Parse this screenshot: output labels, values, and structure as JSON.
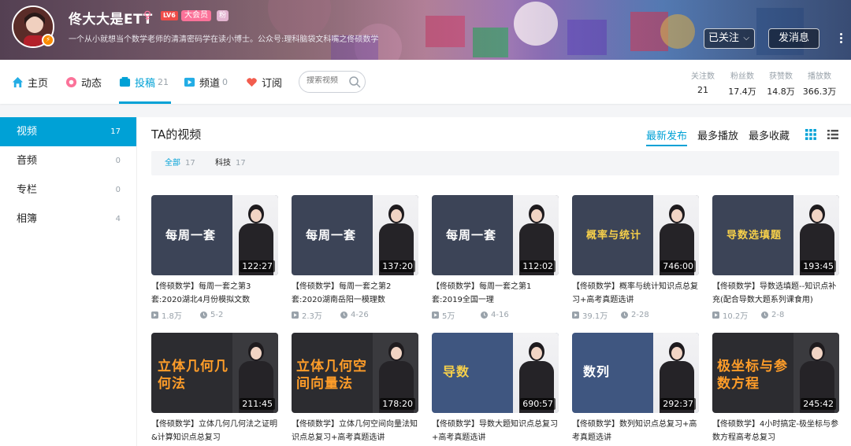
{
  "header": {
    "user_name": "佟大大是ETT",
    "level": "LV6",
    "vip": "大会员",
    "medal": "粉",
    "sign": "一个从小就想当个数学老师的清清密码学在读小博士。公众号:理科脑袋文科嘴之佟硕数学",
    "follow_label": "已关注",
    "message_label": "发消息"
  },
  "nav": {
    "tabs": [
      {
        "label": "主页",
        "count": ""
      },
      {
        "label": "动态",
        "count": ""
      },
      {
        "label": "投稿",
        "count": "21"
      },
      {
        "label": "频道",
        "count": "0"
      },
      {
        "label": "订阅",
        "count": ""
      }
    ],
    "search_placeholder": "搜索视频",
    "stats": [
      {
        "label": "关注数",
        "value": "21"
      },
      {
        "label": "粉丝数",
        "value": "17.4万"
      },
      {
        "label": "获赞数",
        "value": "14.8万"
      },
      {
        "label": "播放数",
        "value": "366.3万"
      }
    ]
  },
  "sidebar": {
    "items": [
      {
        "label": "视频",
        "count": "17"
      },
      {
        "label": "音频",
        "count": "0"
      },
      {
        "label": "专栏",
        "count": "0"
      },
      {
        "label": "相簿",
        "count": "4"
      }
    ]
  },
  "main": {
    "title": "TA的视频",
    "sort_tabs": [
      "最新发布",
      "最多播放",
      "最多收藏"
    ],
    "filters": [
      {
        "label": "全部",
        "count": "17"
      },
      {
        "label": "科技",
        "count": "17"
      }
    ],
    "videos": [
      {
        "cover": "每周一套",
        "duration": "122:27",
        "title": "【佟硕数学】每周一套之第3套:2020湖北4月份模拟文数",
        "plays": "1.8万",
        "date": "5-2"
      },
      {
        "cover": "每周一套",
        "duration": "137:20",
        "title": "【佟硕数学】每周一套之第2套:2020湖南岳阳一模理数",
        "plays": "2.3万",
        "date": "4-26"
      },
      {
        "cover": "每周一套",
        "duration": "112:02",
        "title": "【佟硕数学】每周一套之第1套:2019全国一理",
        "plays": "5万",
        "date": "4-16"
      },
      {
        "cover": "概率与统计",
        "duration": "746:00",
        "title": "【佟硕数学】概率与统计知识点总复习+高考真题选讲",
        "plays": "39.1万",
        "date": "2-28"
      },
      {
        "cover": "导数选填题",
        "duration": "193:45",
        "title": "【佟硕数学】导数选填题--知识点补充(配合导数大题系列课食用)",
        "plays": "10.2万",
        "date": "2-8"
      },
      {
        "cover": "立体几何几何法",
        "duration": "211:45",
        "title": "【佟硕数学】立体几何几何法之证明&计算知识点总复习",
        "plays": "",
        "date": ""
      },
      {
        "cover": "立体几何空间向量法",
        "duration": "178:20",
        "title": "【佟硕数学】立体几何空间向量法知识点总复习+高考真题选讲",
        "plays": "",
        "date": ""
      },
      {
        "cover": "导数",
        "duration": "690:57",
        "title": "【佟硕数学】导数大题知识点总复习+高考真题选讲",
        "plays": "",
        "date": ""
      },
      {
        "cover": "数列",
        "duration": "292:37",
        "title": "【佟硕数学】数列知识点总复习+高考真题选讲",
        "plays": "",
        "date": ""
      },
      {
        "cover": "极坐标与参数方程",
        "duration": "245:42",
        "title": "【佟硕数学】4小时搞定-极坐标与参数方程高考总复习",
        "plays": "",
        "date": ""
      }
    ]
  },
  "colors": {
    "accent": "#00a1d6",
    "pink": "#fb7299",
    "text": "#222222",
    "muted": "#99a2aa"
  }
}
